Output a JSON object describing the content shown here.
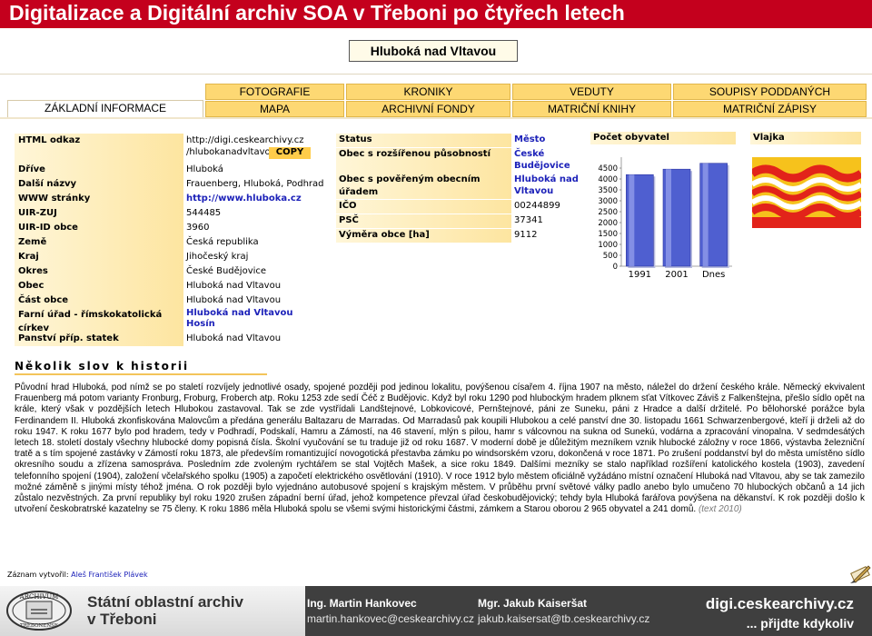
{
  "slide_title": "Digitalizace a Digitální archiv SOA v Třeboni po čtyřech letech",
  "place_name": "Hluboká nad Vltavou",
  "tabs_row1": [
    "FOTOGRAFIE",
    "KRONIKY",
    "VEDUTY",
    "SOUPISY PODDANÝCH"
  ],
  "tabs_row2": [
    "ZÁKLADNÍ INFORMACE",
    "MAPA",
    "ARCHIVNÍ FONDY",
    "MATRIČNÍ KNIHY",
    "MATRIČNÍ ZÁPISY"
  ],
  "info": {
    "html_link_label": "HTML odkaz",
    "html_link_value_1": "http://digi.ceskearchivy.cz",
    "html_link_value_2": "/hlubokanadvltavou",
    "copy_label": "COPY",
    "rows": [
      {
        "label": "Dříve",
        "value": "Hluboká"
      },
      {
        "label": "Další názvy",
        "value": "Frauenberg, Hluboká, Podhrad"
      },
      {
        "label": "WWW stránky",
        "value": "http://www.hluboka.cz"
      },
      {
        "label": "UIR-ZUJ",
        "value": "544485"
      },
      {
        "label": "UIR-ID obce",
        "value": "3960"
      },
      {
        "label": "Země",
        "value": "Česká republika"
      },
      {
        "label": "Kraj",
        "value": "Jihočeský kraj"
      },
      {
        "label": "Okres",
        "value": "České Budějovice"
      },
      {
        "label": "Obec",
        "value": "Hluboká nad Vltavou"
      },
      {
        "label": "Část obce",
        "value": "Hluboká nad Vltavou"
      }
    ],
    "parish_label": "Farní úřad - římskokatolická církev",
    "parish_value_1": "Hluboká nad Vltavou",
    "parish_value_2": "Hosín",
    "estate_label": "Panství příp. statek",
    "estate_value": "Hluboká nad Vltavou"
  },
  "status": {
    "status_label": "Status",
    "status_value": "Město",
    "ext_label": "Obec s rozšířenou působností",
    "ext_value_1": "České",
    "ext_value_2": "Budějovice",
    "auth_label": "Obec s pověřeným obecním úřadem",
    "auth_value_1": "Hluboká nad",
    "auth_value_2": "Vltavou",
    "ico_label": "IČO",
    "ico_value": "00244899",
    "psc_label": "PSČ",
    "psc_value": "37341",
    "area_label": "Výměra obce [ha]",
    "area_value": "9112"
  },
  "population_heading": "Počet obyvatel",
  "flag_heading": "Vlajka",
  "chart_data": {
    "type": "bar",
    "categories": [
      "1991",
      "2001",
      "Dnes"
    ],
    "values": [
      4200,
      4450,
      4720
    ],
    "ylim": [
      0,
      4500
    ],
    "yticks": [
      "0",
      "500",
      "1000",
      "1500",
      "2000",
      "2500",
      "3000",
      "3500",
      "4000",
      "4500"
    ],
    "bar_color": "#4f5fd0"
  },
  "history": {
    "heading": "Několik slov k historii",
    "text": "Původní hrad Hluboká, pod nímž se po staletí rozvíjely jednotlivé osady, spojené později pod jedinou lokalitu, povýšenou císařem 4. října 1907 na město, náležel do držení českého krále. Německý ekvivalent Frauenberg má potom varianty Fronburg, Froburg, Froberch atp. Roku 1253 zde sedí Čéč z Budějovic. Když byl roku 1290 pod hlubockým hradem plknem sťat Vítkovec Záviš z Falkenštejna, přešlo sídlo opět na krále, který však v pozdějších letech Hlubokou zastavoval. Tak se zde vystřídali Landštejnové, Lobkovicové, Pernštejnové, páni ze Suneku, páni z Hradce a další držitelé. Po bělohorské porážce byla Ferdinandem II. Hluboká zkonfiskována Malovcům a předána generálu Baltazaru de Marradas. Od Marradasů pak koupili Hlubokou a celé panství dne 30. listopadu 1661 Schwarzenbergové, kteří ji drželi až do roku 1947. K roku 1677 bylo pod hradem, tedy v Podhradí, Podskalí, Hamru a Zámostí, na 46 stavení, mlýn s pilou, hamr s válcovnou na sukna od Sunekú, vodárna a zpracování vinopalna. V sedmdesátých letech 18. století dostaly všechny hlubocké domy popisná čísla. Školní vyučování se tu traduje již od roku 1687. V moderní době je důležitým mezníkem vznik hlubocké záložny v roce 1866, výstavba železniční tratě a s tím spojené zastávky v Zámostí roku 1873, ale především romantizující novogotická přestavba zámku po windsorském vzoru, dokončená v roce 1871. Po zrušení poddanství byl do města umístěno sídlo okresního soudu a zřízena samospráva. Posledním zde zvoleným rychtářem se stal Vojtěch Mašek, a sice roku 1849. Dalšími mezníky se stalo například rozšíření katolického kostela (1903), zavedení telefonního spojení (1904), založení včelařského spolku (1905) a započetí elektrického osvětlování (1910). V roce 1912 bylo městem oficiálně vyžádáno místní označení Hluboká nad Vltavou, aby se tak zamezilo možné záměně s jinými místy téhož jména. O rok později bylo vyjednáno autobusové spojení s krajským městem. V průběhu první světové války padlo anebo bylo umučeno 70 hlubockých občanů a 14 jich zůstalo nezvěstných. Za první republiky byl roku 1920 zrušen západní berní úřad, jehož kompetence převzal úřad českobudějovický; tehdy byla Hluboká farářova povýšena na děkanství. K rok později došlo k utvoření českobratrské kazatelny se 75 členy. K roku 1886 měla Hluboká spolu se všemi svými historickými částmi, zámkem a Starou oborou 2 965 obyvatel a 241 domů.",
    "note": "(text 2010)"
  },
  "creator_label": "Záznam vytvořil:",
  "creator_name": "Aleš František Plávek",
  "footer": {
    "seal_top": "ARCHIVUM",
    "seal_bottom": "TREBONENSE",
    "org_line1": "Státní oblastní archiv",
    "org_line2": "v Třeboni",
    "person1_name": "Ing. Martin Hankovec",
    "person1_email": "martin.hankovec@ceskearchivy.cz",
    "person2_name": "Mgr. Jakub Kaiseršat",
    "person2_email": "jakub.kaisersat@tb.ceskearchivy.cz",
    "site": "digi.ceskearchivy.cz",
    "slogan": "... přijdte kdykoliv"
  }
}
